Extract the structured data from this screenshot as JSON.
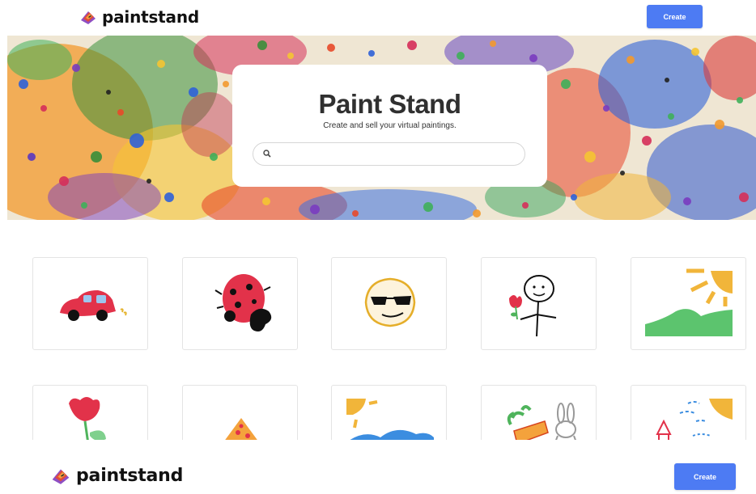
{
  "app": {
    "brand_name": "paintstand",
    "create_label": "Create"
  },
  "hero": {
    "title": "Paint Stand",
    "subtitle": "Create and sell your virtual paintings.",
    "search": {
      "placeholder": "",
      "value": ""
    }
  },
  "gallery": {
    "row1": [
      "red-car",
      "ladybug",
      "sunglasses-face",
      "stick-figure-with-flower",
      "sun-over-hills"
    ],
    "row2": [
      "red-tulip",
      "pizza-slice",
      "sun-over-blue-hills",
      "carrot-and-bunny",
      "colorful-sketch"
    ]
  },
  "colors": {
    "accent": "#4d7bf3",
    "logo_red": "#e14b3b",
    "logo_orange": "#f4a23c",
    "logo_purple": "#8e4fc3"
  },
  "icons": {
    "logo": "paint-brush-stack-icon",
    "search": "search-icon"
  }
}
